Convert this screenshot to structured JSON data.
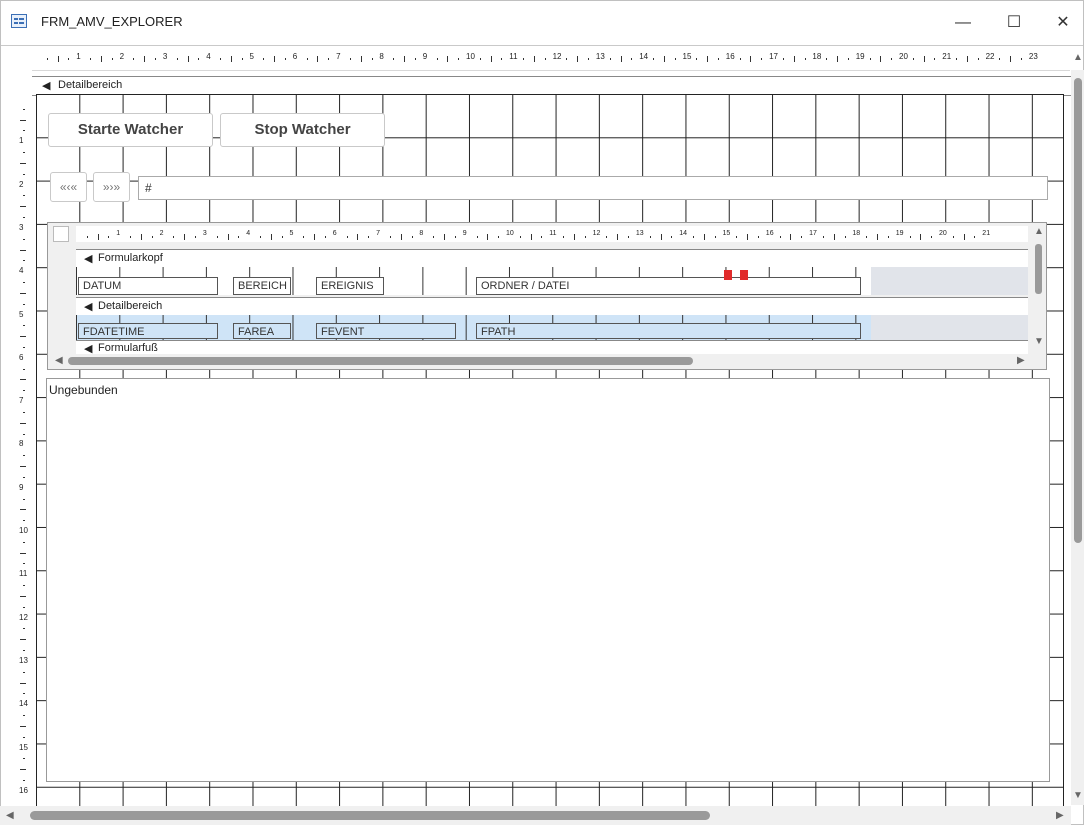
{
  "window": {
    "title": "FRM_AMV_EXPLORER",
    "minimize_glyph": "—",
    "maximize_glyph": "☐",
    "close_glyph": "✕"
  },
  "ruler": {
    "top_labels": [
      "1",
      "2",
      "3",
      "4",
      "5",
      "6",
      "7",
      "8",
      "9",
      "10",
      "11",
      "12",
      "13",
      "14",
      "15",
      "16",
      "17",
      "18",
      "19",
      "20",
      "21",
      "22",
      "23"
    ],
    "left_labels": [
      "1",
      "2",
      "3",
      "4",
      "5",
      "6",
      "7",
      "8",
      "9",
      "10",
      "11",
      "12",
      "13",
      "14",
      "15",
      "16"
    ]
  },
  "sections": {
    "detail_label": "Detailbereich"
  },
  "buttons": {
    "start_label": "Starte Watcher",
    "stop_label": "Stop Watcher",
    "prev_label": "«‹«",
    "next_label": "»›»"
  },
  "nav": {
    "field_value": "#"
  },
  "subform": {
    "ruler_labels": [
      "1",
      "2",
      "3",
      "4",
      "5",
      "6",
      "7",
      "8",
      "9",
      "10",
      "11",
      "12",
      "13",
      "14",
      "15",
      "16",
      "17",
      "18",
      "19",
      "20",
      "21"
    ],
    "header_section": "Formularkopf",
    "detail_section": "Detailbereich",
    "footer_section": "Formularfuß",
    "header_labels": [
      "DATUM",
      "BEREICH",
      "EREIGNIS",
      "ORDNER / DATEI"
    ],
    "detail_fields": [
      "FDATETIME",
      "FAREA",
      "FEVENT",
      "FPATH"
    ]
  },
  "unbound": {
    "label": "Ungebunden"
  }
}
